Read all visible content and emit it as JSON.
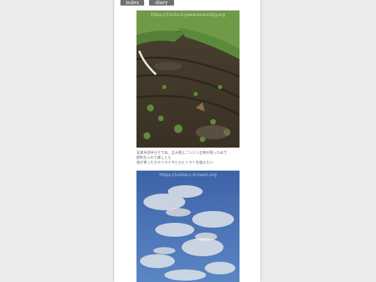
{
  "nav": {
    "index_label": "index",
    "diary_index_label": "diary index"
  },
  "photos": {
    "field": {
      "alt": "field",
      "watermark": "https://11o2a.d.yawaranancityy.org"
    },
    "sky": {
      "alt": "sky",
      "watermark": "https://1o24a.c.d.moon.org"
    }
  },
  "caption": {
    "line1": "写真手前半分りであ。古大根とニンジン古芽が残っためで",
    "line2": "肥料を入れて耕しとえ",
    "line3": "苗が育ったらサツマイモとかとトマトを植えたい"
  },
  "colors": {
    "nav_button": "#6f6f6f",
    "page_background": "#ebebeb"
  }
}
